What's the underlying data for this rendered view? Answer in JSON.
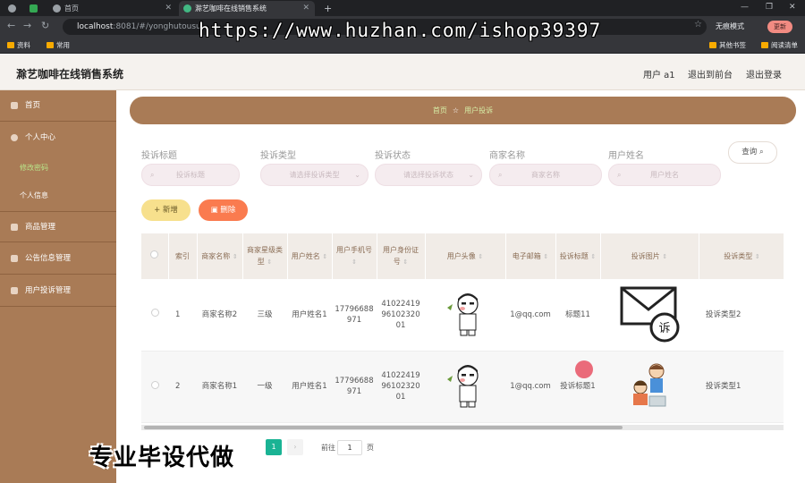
{
  "browser": {
    "tabs": [
      {
        "label": ""
      },
      {
        "label": ""
      },
      {
        "label": "首页"
      },
      {
        "label": "滁艺咖啡在线销售系统"
      }
    ],
    "url_host": "localhost",
    "url_rest": ":8081/#/yonghutousu",
    "watermark": "https://www.huzhan.com/ishop39397",
    "incognito": "无痕模式",
    "update": "更新",
    "bookmarks": [
      {
        "label": "资料"
      },
      {
        "label": "常用"
      },
      {
        "label": "其他书签"
      },
      {
        "label": "阅读清单"
      }
    ]
  },
  "header": {
    "title": "滁艺咖啡在线销售系统",
    "user": "用户 a1",
    "front": "退出到前台",
    "logout": "退出登录"
  },
  "sidebar": {
    "items": [
      {
        "label": "首页"
      },
      {
        "label": "个人中心"
      },
      {
        "label": "修改密码"
      },
      {
        "label": "个人信息"
      },
      {
        "label": "商品管理"
      },
      {
        "label": "公告信息管理"
      },
      {
        "label": "用户投诉管理"
      }
    ]
  },
  "breadcrumb": {
    "home": "首页",
    "current": "用户投诉"
  },
  "filters": [
    {
      "label": "投诉标题",
      "placeholder": "投诉标题"
    },
    {
      "label": "投诉类型",
      "placeholder": "请选择投诉类型"
    },
    {
      "label": "投诉状态",
      "placeholder": "请选择投诉状态"
    },
    {
      "label": "商家名称",
      "placeholder": "商家名称"
    },
    {
      "label": "用户姓名",
      "placeholder": "用户姓名"
    }
  ],
  "buttons": {
    "query": "查询",
    "add": "新增",
    "delete": "删除"
  },
  "table": {
    "headers": [
      "",
      "索引",
      "商家名称",
      "商家星级类型",
      "用户姓名",
      "用户手机号",
      "用户身份证号",
      "用户头像",
      "电子邮箱",
      "投诉标题",
      "投诉图片",
      "投诉类型"
    ],
    "rows": [
      {
        "index": "1",
        "shop": "商家名称2",
        "level": "三级",
        "user": "用户姓名1",
        "phone": "17796688971",
        "idcard": "410224199610232001",
        "email": "1@qq.com",
        "title": "标题11",
        "type": "投诉类型2"
      },
      {
        "index": "2",
        "shop": "商家名称1",
        "level": "一级",
        "user": "用户姓名1",
        "phone": "17796688971",
        "idcard": "410224199610232001",
        "email": "1@qq.com",
        "title": "投诉标题1",
        "type": "投诉类型1"
      }
    ]
  },
  "pagination": {
    "current": "1",
    "goto_label": "前往",
    "goto_value": "1",
    "page_suffix": "页"
  },
  "overlay": "专业毕设代做",
  "colors": {
    "sidebar": "#a97b56",
    "accent_green": "#1ab394",
    "add": "#f7e08d",
    "delete": "#fa7b4f"
  }
}
